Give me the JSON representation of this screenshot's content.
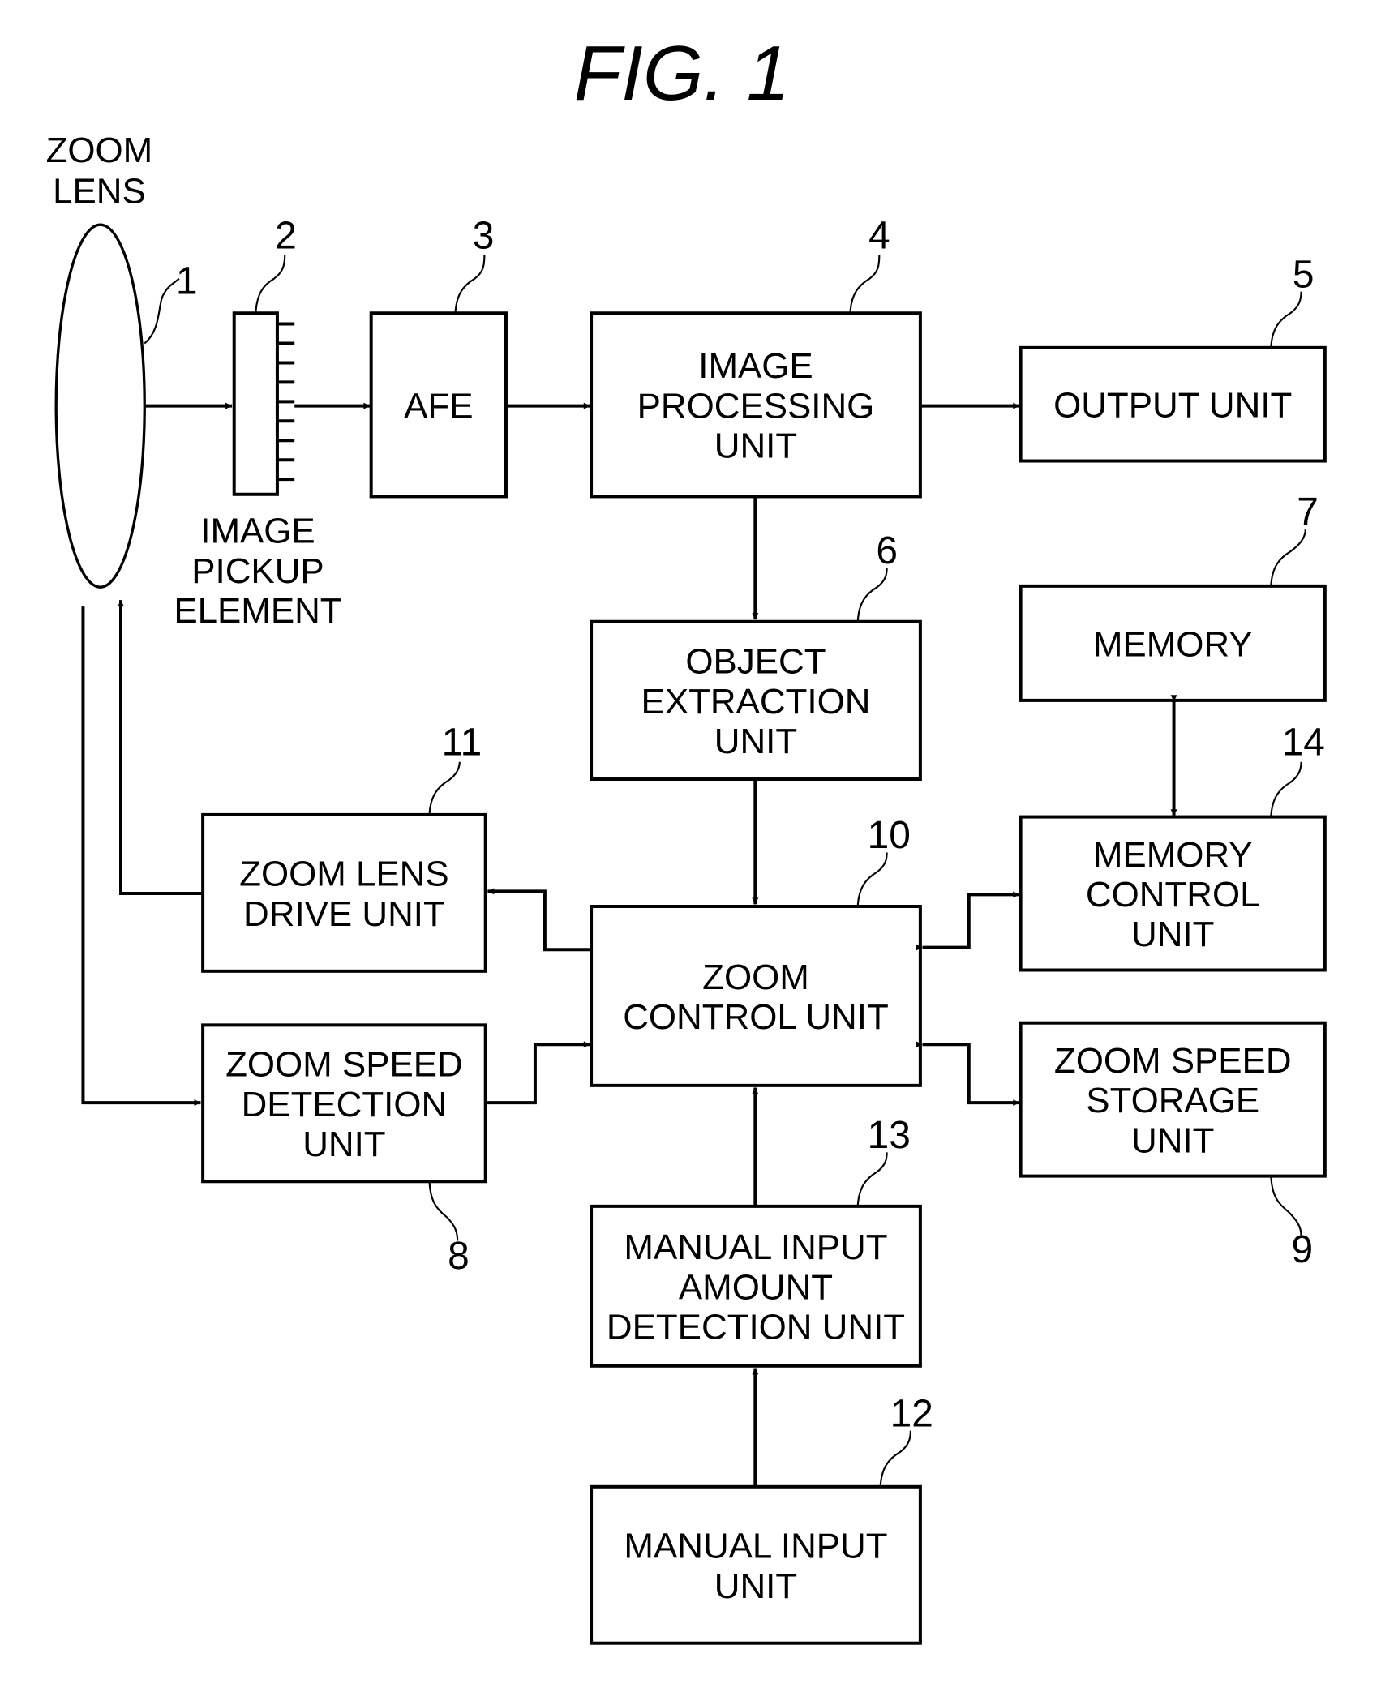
{
  "figure": {
    "title": "FIG.  1"
  },
  "lens": {
    "caption": [
      "ZOOM",
      "LENS"
    ],
    "ref": "1"
  },
  "pickup": {
    "caption": [
      "IMAGE",
      "PICKUP",
      "ELEMENT"
    ],
    "ref": "2"
  },
  "blocks": [
    {
      "id": "afe",
      "ref": "3",
      "lines": [
        "AFE"
      ]
    },
    {
      "id": "image-processing-unit",
      "ref": "4",
      "lines": [
        "IMAGE",
        "PROCESSING",
        "UNIT"
      ]
    },
    {
      "id": "output-unit",
      "ref": "5",
      "lines": [
        "OUTPUT UNIT"
      ]
    },
    {
      "id": "object-extraction-unit",
      "ref": "6",
      "lines": [
        "OBJECT",
        "EXTRACTION",
        "UNIT"
      ]
    },
    {
      "id": "memory",
      "ref": "7",
      "lines": [
        "MEMORY"
      ]
    },
    {
      "id": "zoom-speed-detection-unit",
      "ref": "8",
      "lines": [
        "ZOOM SPEED",
        "DETECTION",
        "UNIT"
      ]
    },
    {
      "id": "zoom-speed-storage-unit",
      "ref": "9",
      "lines": [
        "ZOOM SPEED",
        "STORAGE",
        "UNIT"
      ]
    },
    {
      "id": "zoom-control-unit",
      "ref": "10",
      "lines": [
        "ZOOM",
        "CONTROL UNIT"
      ]
    },
    {
      "id": "zoom-lens-drive-unit",
      "ref": "11",
      "lines": [
        "ZOOM LENS",
        "DRIVE UNIT"
      ]
    },
    {
      "id": "manual-input-unit",
      "ref": "12",
      "lines": [
        "MANUAL INPUT",
        "UNIT"
      ]
    },
    {
      "id": "manual-input-amount-detection-unit",
      "ref": "13",
      "lines": [
        "MANUAL INPUT",
        "AMOUNT",
        "DETECTION UNIT"
      ]
    },
    {
      "id": "memory-control-unit",
      "ref": "14",
      "lines": [
        "MEMORY",
        "CONTROL",
        "UNIT"
      ]
    }
  ],
  "connections": [
    {
      "from": "zoom-lens",
      "to": "image-pickup-element",
      "type": "arrow"
    },
    {
      "from": "image-pickup-element",
      "to": "afe",
      "type": "arrow"
    },
    {
      "from": "afe",
      "to": "image-processing-unit",
      "type": "arrow"
    },
    {
      "from": "image-processing-unit",
      "to": "output-unit",
      "type": "arrow"
    },
    {
      "from": "image-processing-unit",
      "to": "object-extraction-unit",
      "type": "arrow"
    },
    {
      "from": "object-extraction-unit",
      "to": "zoom-control-unit",
      "type": "arrow"
    },
    {
      "from": "memory",
      "to": "memory-control-unit",
      "type": "bidirectional"
    },
    {
      "from": "zoom-control-unit",
      "to": "memory-control-unit",
      "type": "bidirectional"
    },
    {
      "from": "zoom-control-unit",
      "to": "zoom-speed-storage-unit",
      "type": "bidirectional"
    },
    {
      "from": "zoom-control-unit",
      "to": "zoom-lens-drive-unit",
      "type": "arrow"
    },
    {
      "from": "zoom-lens-drive-unit",
      "to": "zoom-lens",
      "type": "arrow"
    },
    {
      "from": "zoom-lens",
      "to": "zoom-speed-detection-unit",
      "type": "arrow"
    },
    {
      "from": "zoom-speed-detection-unit",
      "to": "zoom-control-unit",
      "type": "arrow"
    },
    {
      "from": "manual-input-amount-detection-unit",
      "to": "zoom-control-unit",
      "type": "arrow"
    },
    {
      "from": "manual-input-unit",
      "to": "manual-input-amount-detection-unit",
      "type": "arrow"
    }
  ]
}
